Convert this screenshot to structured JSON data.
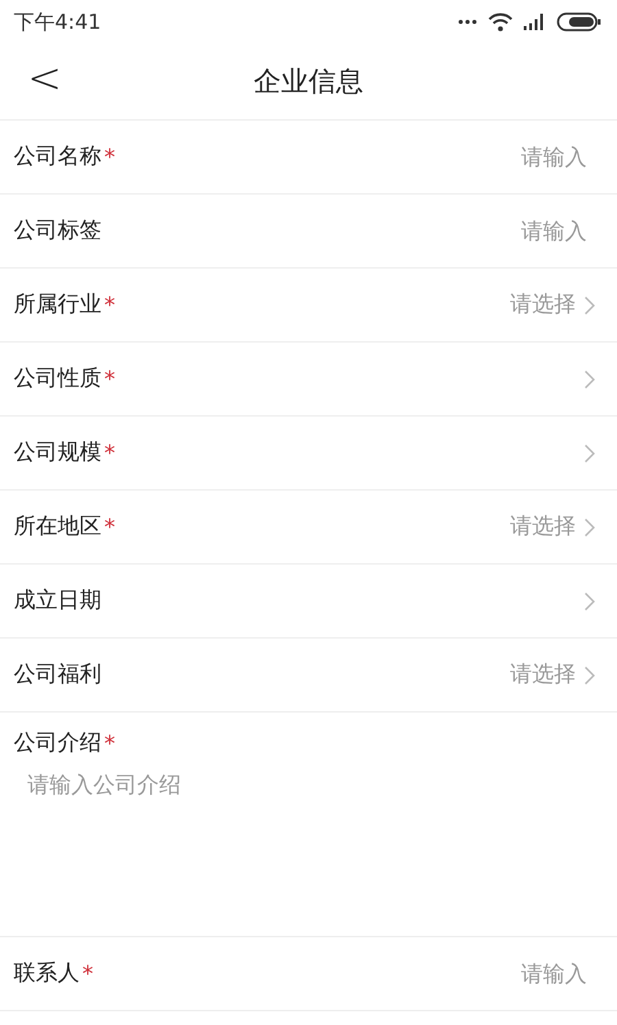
{
  "status_bar": {
    "time": "下午4:41"
  },
  "nav": {
    "back": "<",
    "title": "企业信息"
  },
  "rows": [
    {
      "kind": "input",
      "label": "公司名称",
      "required_mark": "*",
      "placeholder": "请输入"
    },
    {
      "kind": "input",
      "label": "公司标签",
      "placeholder": "请输入"
    },
    {
      "kind": "select",
      "label": "所属行业",
      "required_mark": "*",
      "placeholder": "请选择"
    },
    {
      "kind": "select",
      "label": "公司性质",
      "required_mark": "*"
    },
    {
      "kind": "select",
      "label": "公司规模",
      "required_mark": "*"
    },
    {
      "kind": "select",
      "label": "所在地区",
      "required_mark": "*",
      "placeholder": "请选择"
    },
    {
      "kind": "select",
      "label": "成立日期"
    },
    {
      "kind": "select",
      "label": "公司福利",
      "placeholder": "请选择"
    },
    {
      "kind": "textarea",
      "label": "公司介绍",
      "required_mark": "*",
      "placeholder": "请输入公司介绍"
    },
    {
      "kind": "input",
      "label": "联系人",
      "required_mark": "*",
      "placeholder": "请输入"
    }
  ]
}
